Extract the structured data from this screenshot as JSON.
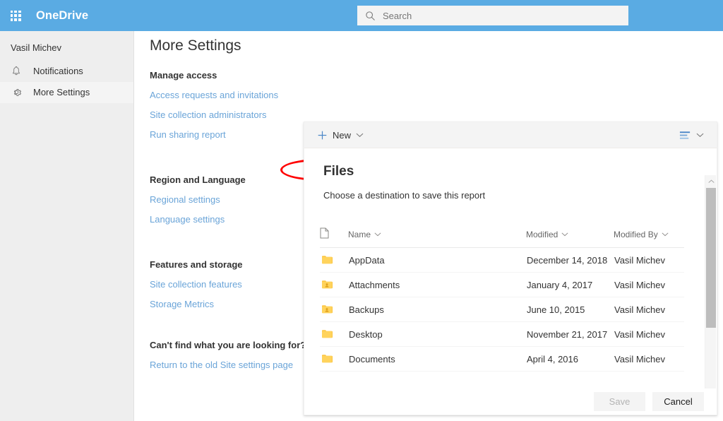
{
  "suitebar": {
    "waffle_label": "App launcher",
    "brand": "OneDrive",
    "search_placeholder": "Search",
    "search_value": "",
    "brand_color": "#5aabe3"
  },
  "leftnav": {
    "user": "Vasil Michev",
    "items": [
      {
        "label": "Notifications",
        "icon": "bell-icon",
        "selected": false
      },
      {
        "label": "More Settings",
        "icon": "gear-icon",
        "selected": true
      }
    ]
  },
  "main": {
    "page_title": "More Settings",
    "groups": [
      {
        "heading": "Manage access",
        "links": [
          "Access requests and invitations",
          "Site collection administrators",
          "Run sharing report"
        ]
      },
      {
        "heading": "Region and Language",
        "links": [
          "Regional settings",
          "Language settings"
        ]
      },
      {
        "heading": "Features and storage",
        "links": [
          "Site collection features",
          "Storage Metrics"
        ]
      },
      {
        "heading": "Can't find what you are looking for?",
        "links": [
          "Return to the old Site settings page"
        ]
      }
    ],
    "annotation": {
      "shape": "ellipse",
      "color": "#ff0000",
      "targets": "Run sharing report"
    },
    "link_color": "#6aa4d8"
  },
  "dialog": {
    "toolbar": {
      "new_label": "New",
      "new_icon": "plus-icon",
      "new_chevron": "chevron-down-icon",
      "view_icon": "list-view-icon",
      "view_chevron": "chevron-down-icon"
    },
    "title": "Files",
    "subtitle": "Choose a destination to save this report",
    "columns": [
      {
        "key": "icon",
        "label": "",
        "icon": "document-icon",
        "sortable": false
      },
      {
        "key": "name",
        "label": "Name",
        "sortable": true
      },
      {
        "key": "modified",
        "label": "Modified",
        "sortable": true
      },
      {
        "key": "modified_by",
        "label": "Modified By",
        "sortable": true
      }
    ],
    "rows": [
      {
        "icon": "folder-icon",
        "name": "AppData",
        "modified": "December 14, 2018",
        "modified_by": "Vasil Michev"
      },
      {
        "icon": "folder-shared-icon",
        "name": "Attachments",
        "modified": "January 4, 2017",
        "modified_by": "Vasil Michev"
      },
      {
        "icon": "folder-shared-icon",
        "name": "Backups",
        "modified": "June 10, 2015",
        "modified_by": "Vasil Michev"
      },
      {
        "icon": "folder-icon",
        "name": "Desktop",
        "modified": "November 21, 2017",
        "modified_by": "Vasil Michev"
      },
      {
        "icon": "folder-icon",
        "name": "Documents",
        "modified": "April 4, 2016",
        "modified_by": "Vasil Michev"
      }
    ],
    "buttons": {
      "save": "Save",
      "save_disabled": true,
      "cancel": "Cancel"
    },
    "scrollbar": {
      "up_icon": "chevron-up-icon",
      "down_icon": "chevron-down-icon"
    }
  }
}
